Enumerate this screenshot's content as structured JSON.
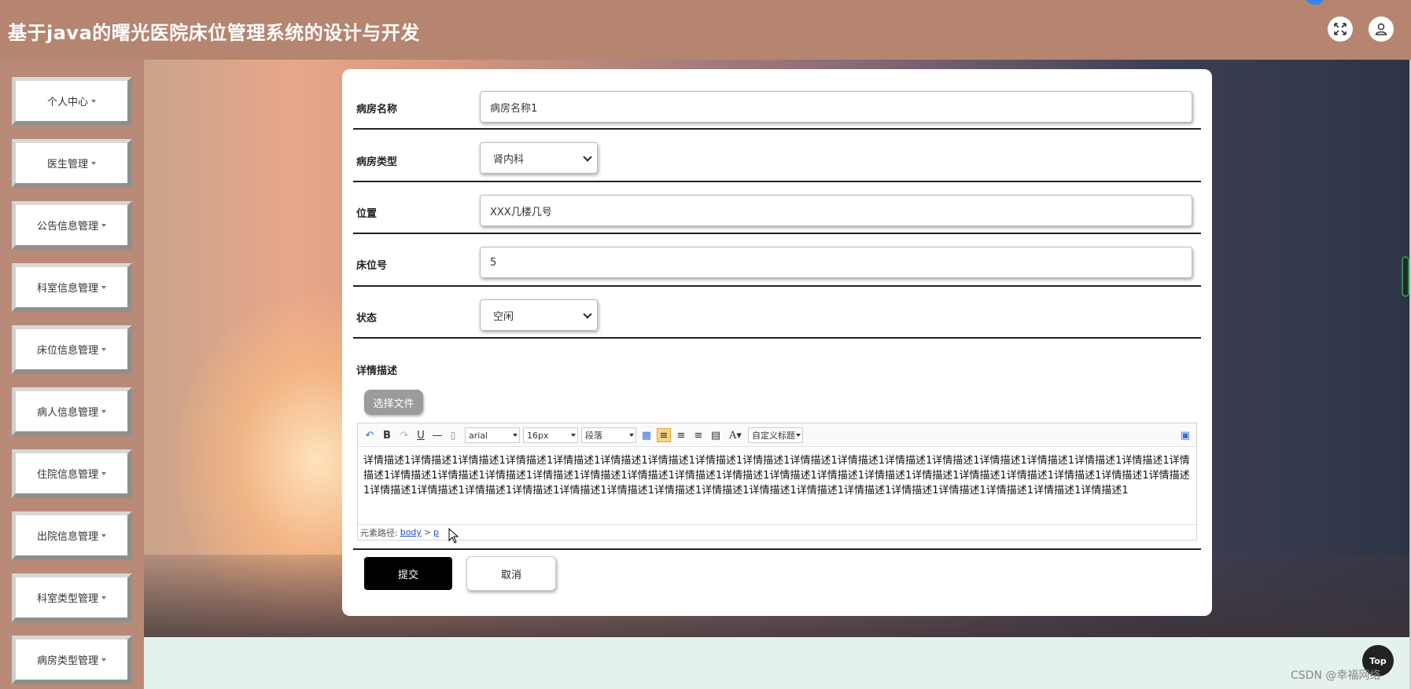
{
  "header": {
    "title": "基于java的曙光医院床位管理系统的设计与开发",
    "fullscreen_icon": "fullscreen-icon",
    "user_icon": "user-icon"
  },
  "sidebar": {
    "items": [
      {
        "label": "个人中心"
      },
      {
        "label": "医生管理"
      },
      {
        "label": "公告信息管理"
      },
      {
        "label": "科室信息管理"
      },
      {
        "label": "床位信息管理"
      },
      {
        "label": "病人信息管理"
      },
      {
        "label": "住院信息管理"
      },
      {
        "label": "出院信息管理"
      },
      {
        "label": "科室类型管理"
      },
      {
        "label": "病房类型管理"
      }
    ]
  },
  "form": {
    "ward_name": {
      "label": "病房名称",
      "value": "病房名称1"
    },
    "ward_type": {
      "label": "病房类型",
      "value": "肾内科"
    },
    "location": {
      "label": "位置",
      "value": "XXX几楼几号"
    },
    "bed_number": {
      "label": "床位号",
      "value": "5"
    },
    "status": {
      "label": "状态",
      "value": "空闲"
    },
    "details": {
      "label": "详情描述"
    },
    "choose_file": "选择文件",
    "submit": "提交",
    "cancel": "取消"
  },
  "editor": {
    "font_family": "arial",
    "font_size": "16px",
    "paragraph": "段落",
    "custom_title": "自定义标题",
    "content": "详情描述1详情描述1详情描述1详情描述1详情描述1详情描述1详情描述1详情描述1详情描述1详情描述1详情描述1详情描述1详情描述1详情描述1详情描述1详情描述1详情描述1详情描述1详情描述1详情描述1详情描述1详情描述1详情描述1详情描述1详情描述1详情描述1详情描述1详情描述1详情描述1详情描述1详情描述1详情描述1详情描述1详情描述1详情描述1详情描述1详情描述1详情描述1详情描述1详情描述1详情描述1详情描述1详情描述1详情描述1详情描述1详情描述1详情描述1详情描述1详情描述1详情描述1详情描述1",
    "path_label": "元素路径:",
    "path_body": "body",
    "path_sep": ">",
    "path_p": "p"
  },
  "footer": {
    "top_button": "Top",
    "watermark": "CSDN @幸福网络"
  },
  "colors": {
    "header_bg": "#b58570",
    "sidebar_bg": "#b98a78",
    "submit_bg": "#000000"
  }
}
